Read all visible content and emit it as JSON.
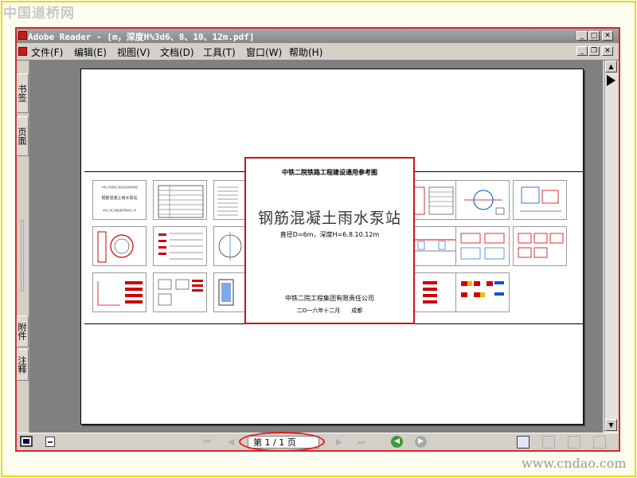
{
  "watermark": {
    "top": "中国道桥网",
    "bottom": "www.cndao.com"
  },
  "window": {
    "title": "Adobe Reader - [m，深度H%3d6、8、10、12m.pdf]"
  },
  "menu": {
    "items": [
      {
        "label": "文件(F)"
      },
      {
        "label": "编辑(E)"
      },
      {
        "label": "视图(V)"
      },
      {
        "label": "文档(D)"
      },
      {
        "label": "工具(T)"
      },
      {
        "label": "窗口(W)"
      },
      {
        "label": "帮助(H)"
      }
    ]
  },
  "side_tabs": {
    "bookmarks": "书签",
    "pages": "页面",
    "attachments": "附件",
    "comments": "注释"
  },
  "cover": {
    "org": "中铁二院铁路工程建设通用参考图",
    "title": "钢筋混凝土雨水泵站",
    "params": "直径D=6m，深度H=6.8.10.12m",
    "company": "中铁二院工程集团有限责任公司",
    "date": "二O一六年十二月　　成都"
  },
  "thumbnail": {
    "title_lines": [
      "中铁二院铁路工程建设通用参考图",
      "钢筋混凝土雨水泵站",
      "中铁二院工程集团有限责任公司"
    ]
  },
  "status": {
    "page_indicator": "第 1 / 1 页"
  },
  "colors": {
    "highlight": "#e31c1c",
    "title_bar": "#8f8f8f",
    "frame": "#e8d800",
    "window_border": "#d8262b",
    "forward_nav": "#aaaaaa",
    "back_nav": "#3d9a3d"
  }
}
